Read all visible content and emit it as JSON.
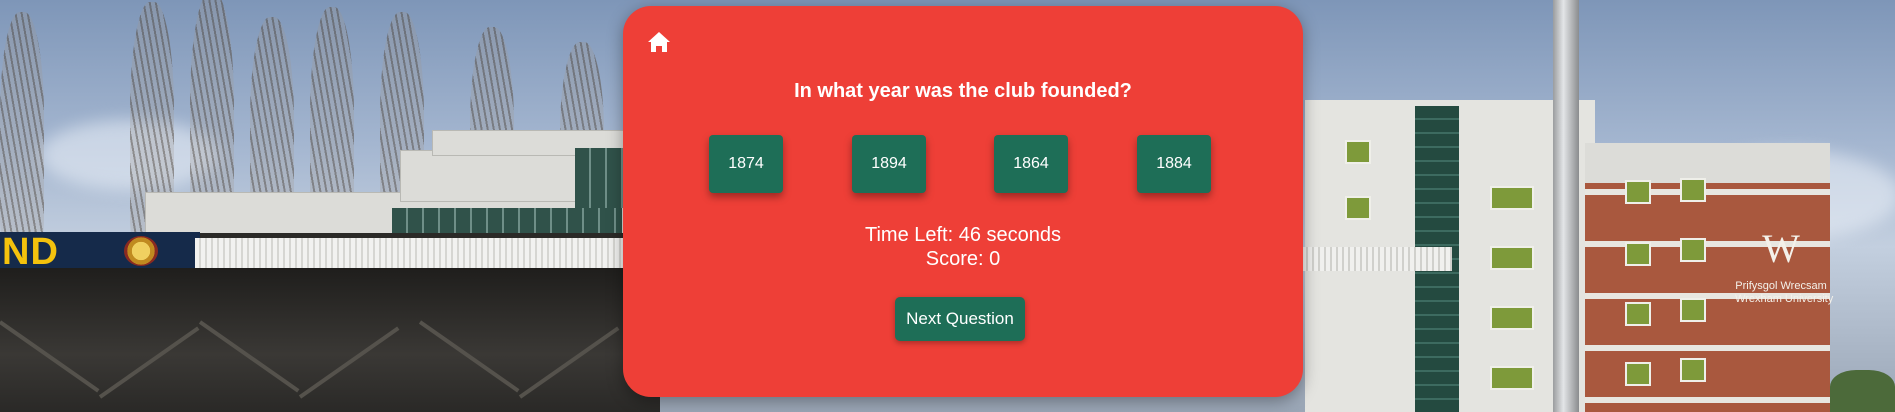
{
  "nav": {
    "home_icon": "home-icon"
  },
  "quiz": {
    "question": "In what year was the club founded?",
    "answers": [
      "1874",
      "1894",
      "1864",
      "1884"
    ],
    "time_left_text": "Time Left: 46 seconds",
    "score_text": "Score: 0",
    "next_label": "Next Question"
  },
  "scene": {
    "stand_text": "ND",
    "building_sign_letter": "W",
    "building_sign_line1": "Prifysgol Wrecsam",
    "building_sign_line2": "Wrexham University"
  },
  "colors": {
    "card": "#ee3f37",
    "button": "#1e6e57",
    "text": "#ffffff"
  }
}
